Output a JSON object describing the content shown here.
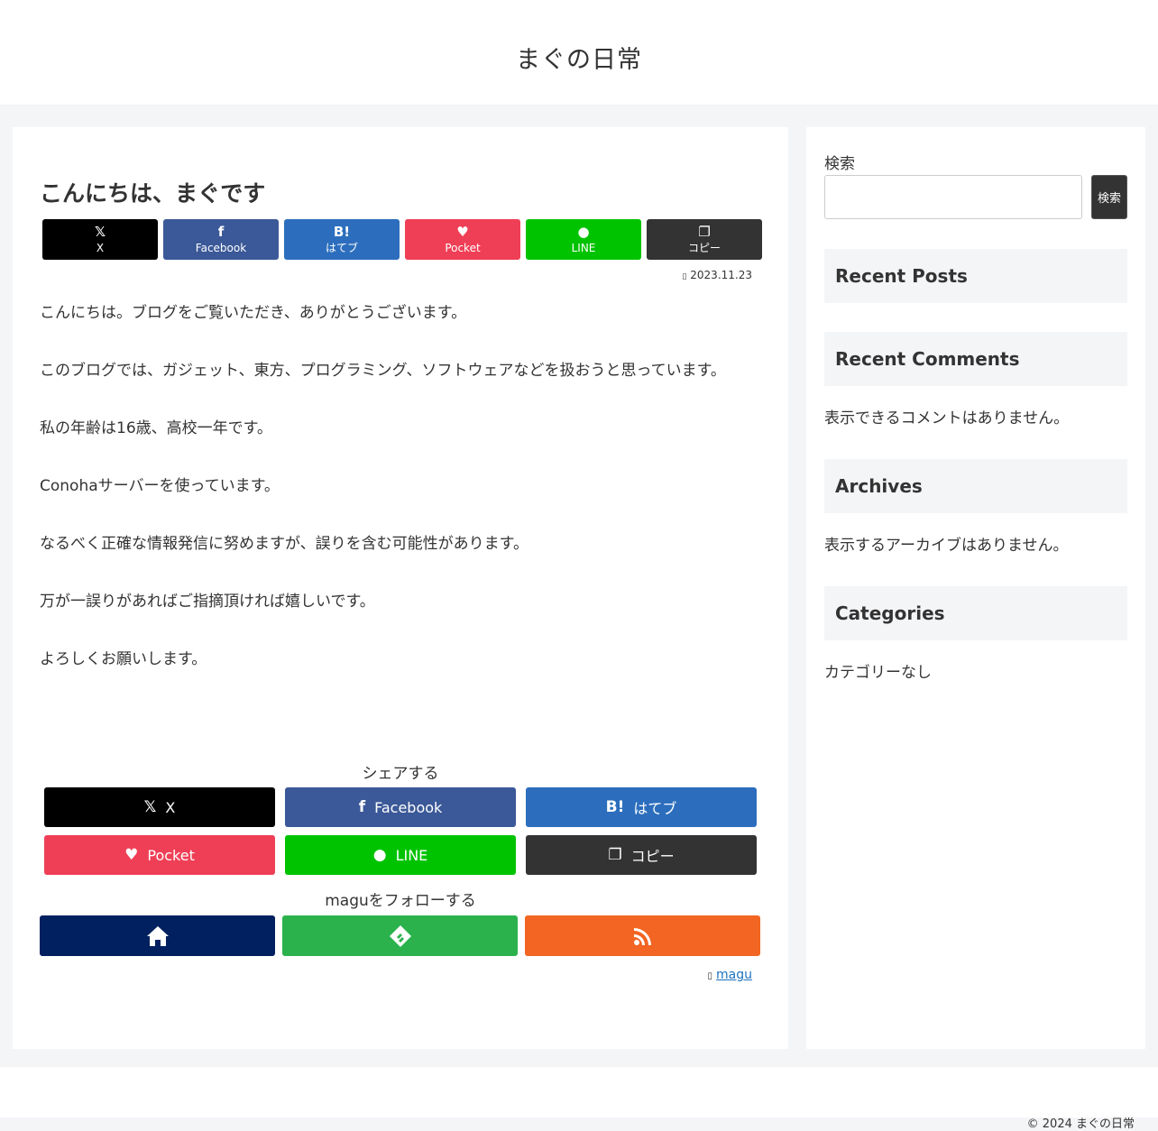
{
  "site": {
    "title": "まぐの日常"
  },
  "post": {
    "title": "こんにちは、まぐです",
    "date": "2023.11.23",
    "date_icon": "clock-icon",
    "paragraphs": [
      "こんにちは。ブログをご覧いただき、ありがとうございます。",
      "このブログでは、ガジェット、東方、プログラミング、ソフトウェアなどを扱おうと思っています。",
      "私の年齢は16歳、高校一年です。",
      "Conohaサーバーを使っています。",
      "なるべく正確な情報発信に努めますが、誤りを含む可能性があります。",
      "万が一誤りがあればご指摘頂ければ嬉しいです。",
      "よろしくお願いします。"
    ]
  },
  "share_top": [
    {
      "label": "X",
      "icon": "x-icon",
      "glyph": "𝕏",
      "color": "#000000"
    },
    {
      "label": "Facebook",
      "icon": "facebook-icon",
      "glyph": "f",
      "color": "#3b5998"
    },
    {
      "label": "はてブ",
      "icon": "hatena-icon",
      "glyph": "B!",
      "color": "#2c6ebd"
    },
    {
      "label": "Pocket",
      "icon": "pocket-icon",
      "glyph": "♥",
      "color": "#ef3f56"
    },
    {
      "label": "LINE",
      "icon": "line-icon",
      "glyph": "●",
      "color": "#00c300"
    },
    {
      "label": "コピー",
      "icon": "copy-icon",
      "glyph": "❐",
      "color": "#333333"
    }
  ],
  "share_bottom": {
    "label": "シェアする",
    "buttons": [
      {
        "label": "X",
        "icon": "x-icon",
        "glyph": "𝕏",
        "color": "#000000"
      },
      {
        "label": "Facebook",
        "icon": "facebook-icon",
        "glyph": "f",
        "color": "#3b5998"
      },
      {
        "label": "はてブ",
        "icon": "hatena-icon",
        "glyph": "B!",
        "color": "#2c6ebd"
      },
      {
        "label": "Pocket",
        "icon": "pocket-icon",
        "glyph": "♥",
        "color": "#ef3f56"
      },
      {
        "label": "LINE",
        "icon": "line-icon",
        "glyph": "●",
        "color": "#00c300"
      },
      {
        "label": "コピー",
        "icon": "copy-icon",
        "glyph": "❐",
        "color": "#333333"
      }
    ]
  },
  "follow": {
    "label": "maguをフォローする",
    "buttons": [
      {
        "icon": "home-icon",
        "color": "#002060"
      },
      {
        "icon": "feedly-icon",
        "color": "#2bb24c"
      },
      {
        "icon": "rss-icon",
        "color": "#f26522"
      }
    ]
  },
  "author": {
    "icon": "person-icon",
    "name": "magu"
  },
  "sidebar": {
    "search_label": "検索",
    "search_button": "検索",
    "search_placeholder": "",
    "widgets": [
      {
        "title": "Recent Posts",
        "text": ""
      },
      {
        "title": "Recent Comments",
        "text": "表示できるコメントはありません。"
      },
      {
        "title": "Archives",
        "text": "表示するアーカイブはありません。"
      },
      {
        "title": "Categories",
        "text": "カテゴリーなし"
      }
    ]
  },
  "footer": {
    "copyright": "© 2024 まぐの日常"
  }
}
